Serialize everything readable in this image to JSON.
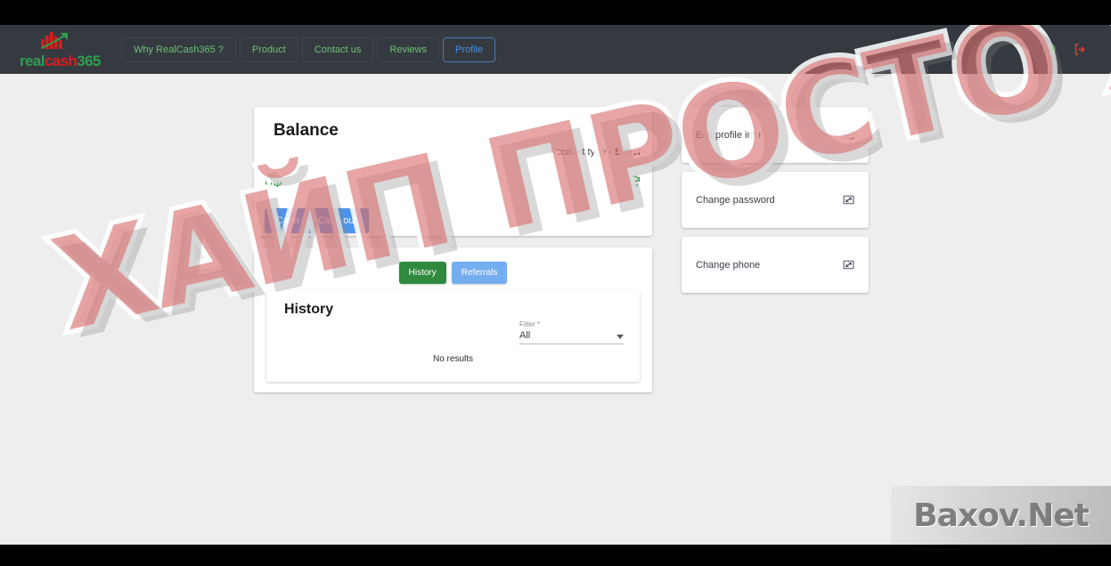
{
  "navbar": {
    "logo": {
      "part1": "real",
      "part2": "cash",
      "part3": "365",
      "icon": "bar-chart-arrow-icon"
    },
    "links": [
      {
        "label": "Why RealCash365 ?",
        "active": false
      },
      {
        "label": "Product",
        "active": false
      },
      {
        "label": "Contact us",
        "active": false
      },
      {
        "label": "Reviews",
        "active": false
      },
      {
        "label": "Profile",
        "active": true
      }
    ],
    "icons": [
      {
        "name": "globe-icon",
        "color": "#4caf50"
      },
      {
        "name": "logout-icon",
        "color": "#e53935"
      }
    ]
  },
  "balance": {
    "title": "Balance",
    "account_type_prefix": "Account type - ",
    "account_type_value": "Silver",
    "amount": "0$",
    "amount_color": "#3aa75a",
    "refresh_icon": "refresh-icon",
    "cash_button": "Cash in  /  Cash out",
    "cash_button_color": "#4d94ec"
  },
  "history": {
    "tabs": [
      {
        "label": "History",
        "color": "#2f8a3e",
        "active": true
      },
      {
        "label": "Referrals",
        "color": "#75aef0",
        "active": false
      }
    ],
    "heading": "History",
    "filter_label": "Filter *",
    "filter_value": "All",
    "empty_text": "No results"
  },
  "profile_actions": [
    {
      "label": "Edit profile info",
      "icon": "open-in-new-icon"
    },
    {
      "label": "Change password",
      "icon": "open-in-new-icon"
    },
    {
      "label": "Change phone",
      "icon": "open-in-new-icon"
    }
  ],
  "watermarks": {
    "main": "ХАЙП ПРОСТО ХАЙП",
    "site": "Baxov.Net"
  }
}
